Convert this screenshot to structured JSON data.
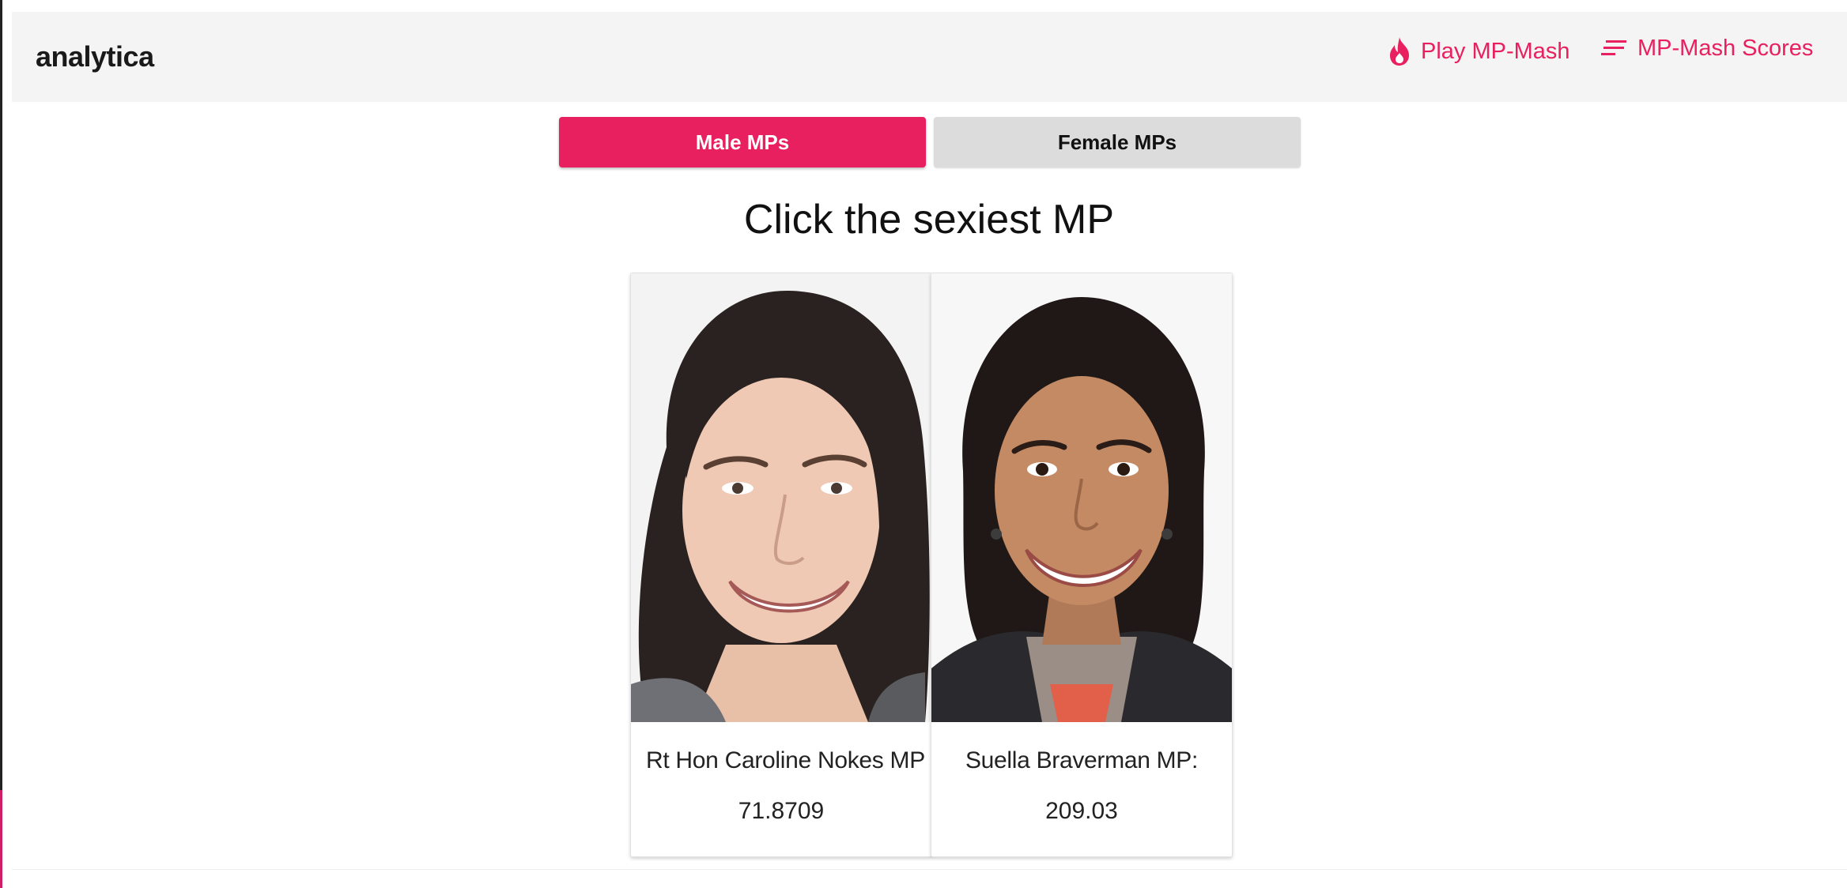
{
  "brand": "analytica",
  "nav": {
    "play_label": "Play MP-Mash",
    "play_icon": "flame-icon",
    "scores_label": "MP-Mash Scores",
    "scores_icon": "sort-lines-icon",
    "accent": "#e8205f"
  },
  "tabs": [
    {
      "label": "Male MPs",
      "active": true
    },
    {
      "label": "Female MPs",
      "active": false
    }
  ],
  "prompt": "Click the sexiest MP",
  "cards": [
    {
      "name": "Rt Hon Caroline Nokes MP",
      "score": "71.8709"
    },
    {
      "name": "Suella Braverman MP:",
      "score": "209.03"
    }
  ]
}
